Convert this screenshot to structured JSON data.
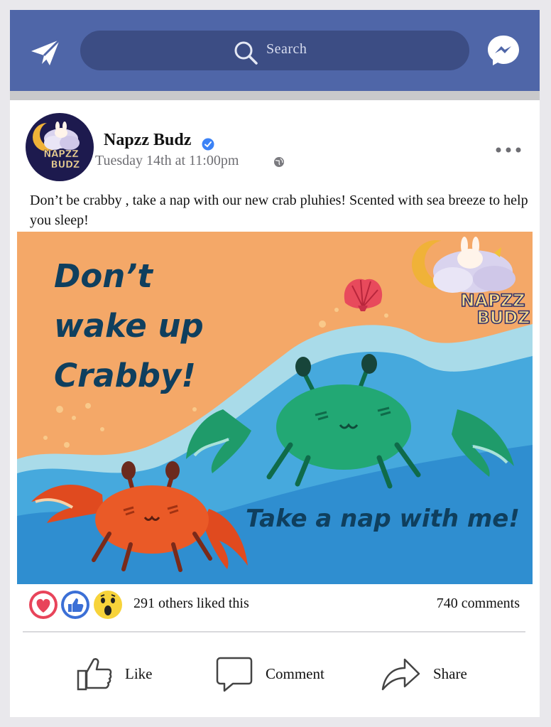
{
  "topbar": {
    "search_placeholder": "Search",
    "send_icon": "paper-plane-icon",
    "messenger_icon": "messenger-icon"
  },
  "post": {
    "author": "Napzz Budz",
    "verified": true,
    "timestamp": "Tuesday 14th at 11:00pm",
    "text": "Don’t be crabby , take a nap with our new crab pluhies! Scented with  sea breeze to help you sleep!",
    "avatar_logo_text": "NAPZZ BUDZ",
    "image": {
      "headline_lines": [
        "Don’t",
        "wake up",
        "Crabby!"
      ],
      "tagline": "Take a nap with me!",
      "brand_lines": [
        "NAPZZ",
        "BUDZ"
      ]
    }
  },
  "stats": {
    "likes_text": "291 others liked this",
    "comments_text": "740 comments",
    "reaction_icons": [
      "love-icon",
      "like-icon",
      "wow-icon"
    ]
  },
  "actions": {
    "like": "Like",
    "comment": "Comment",
    "share": "Share"
  },
  "colors": {
    "topbar": "#4f66a8",
    "search": "#3c4d84",
    "image_sand": "#f4a868",
    "image_sea": "#2f8ed0",
    "headline": "#0f3f5e"
  }
}
